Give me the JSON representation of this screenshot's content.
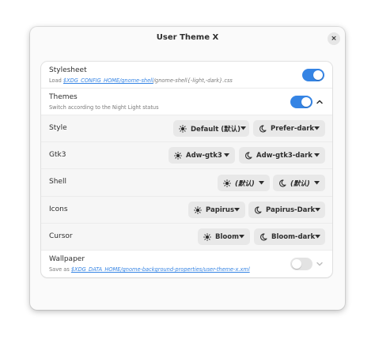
{
  "window": {
    "title": "User Theme X",
    "close_glyph": "×"
  },
  "colors": {
    "accent": "#3584e4",
    "switch_off": "#e3e3e3",
    "dropdown_bg": "#e8e8e8"
  },
  "stylesheet": {
    "title": "Stylesheet",
    "subtitle_prefix": "Load ",
    "subtitle_link": "$XDG_CONFIG_HOME/gnome-shell",
    "subtitle_suffix": "/gnome-shell{-light,-dark}.css",
    "enabled": true
  },
  "themes": {
    "title": "Themes",
    "subtitle": "Switch according to the Night Light status",
    "enabled": true,
    "expanded": true
  },
  "rows": {
    "style": {
      "label": "Style",
      "light": "Default (默认)",
      "dark": "Prefer-dark"
    },
    "gtk3": {
      "label": "Gtk3",
      "light": "Adw-gtk3",
      "dark": "Adw-gtk3-dark"
    },
    "shell": {
      "label": "Shell",
      "light": "(默认)",
      "dark": "(默认)"
    },
    "icons": {
      "label": "Icons",
      "light": "Papirus",
      "dark": "Papirus-Dark"
    },
    "cursor": {
      "label": "Cursor",
      "light": "Bloom",
      "dark": "Bloom-dark"
    }
  },
  "icons": {
    "light": "sun-icon",
    "dark": "moon-icon",
    "caret": "caret-down-icon"
  },
  "wallpaper": {
    "title": "Wallpaper",
    "subtitle_prefix": "Save as ",
    "subtitle_link": "$XDG_DATA_HOME/gnome-background-properties/user-theme-x.xml",
    "enabled": false
  }
}
